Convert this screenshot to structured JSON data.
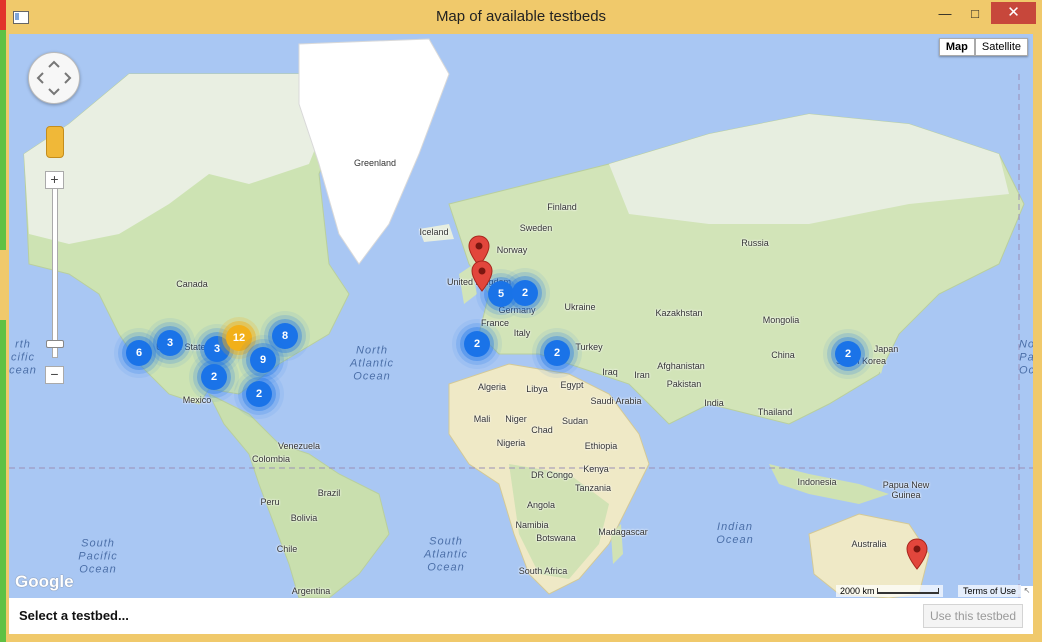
{
  "window": {
    "title": "Map of available testbeds",
    "minimize_glyph": "—",
    "maximize_glyph": "□",
    "close_glyph": "✕"
  },
  "map": {
    "maptype_buttons": [
      "Map",
      "Satellite"
    ],
    "active_maptype": "Map",
    "zoom_in": "+",
    "zoom_out": "−",
    "logo": "Google",
    "scale_text": "2000 km",
    "terms": "Terms of Use",
    "resize_glyph": "↖",
    "labels": [
      {
        "id": "greenland",
        "text": "Greenland"
      },
      {
        "id": "iceland",
        "text": "Iceland"
      },
      {
        "id": "finland",
        "text": "Finland"
      },
      {
        "id": "sweden",
        "text": "Sweden"
      },
      {
        "id": "norway",
        "text": "Norway"
      },
      {
        "id": "russia",
        "text": "Russia"
      },
      {
        "id": "united-kingdom",
        "text": "United Kingdom"
      },
      {
        "id": "germany",
        "text": "Germany"
      },
      {
        "id": "ukraine",
        "text": "Ukraine"
      },
      {
        "id": "france",
        "text": "France"
      },
      {
        "id": "italy",
        "text": "Italy"
      },
      {
        "id": "kazakhstan",
        "text": "Kazakhstan"
      },
      {
        "id": "mongolia",
        "text": "Mongolia"
      },
      {
        "id": "turkey",
        "text": "Turkey"
      },
      {
        "id": "china",
        "text": "China"
      },
      {
        "id": "japan",
        "text": "Japan"
      },
      {
        "id": "south-korea",
        "text": "South Korea"
      },
      {
        "id": "iraq",
        "text": "Iraq"
      },
      {
        "id": "iran",
        "text": "Iran"
      },
      {
        "id": "afghanistan",
        "text": "Afghanistan"
      },
      {
        "id": "pakistan",
        "text": "Pakistan"
      },
      {
        "id": "india",
        "text": "India"
      },
      {
        "id": "thailand",
        "text": "Thailand"
      },
      {
        "id": "saudi-arabia",
        "text": "Saudi Arabia"
      },
      {
        "id": "egypt",
        "text": "Egypt"
      },
      {
        "id": "algeria",
        "text": "Algeria"
      },
      {
        "id": "libya",
        "text": "Libya"
      },
      {
        "id": "mali",
        "text": "Mali"
      },
      {
        "id": "niger",
        "text": "Niger"
      },
      {
        "id": "chad",
        "text": "Chad"
      },
      {
        "id": "sudan",
        "text": "Sudan"
      },
      {
        "id": "nigeria",
        "text": "Nigeria"
      },
      {
        "id": "ethiopia",
        "text": "Ethiopia"
      },
      {
        "id": "dr-congo",
        "text": "DR Congo"
      },
      {
        "id": "kenya",
        "text": "Kenya"
      },
      {
        "id": "tanzania",
        "text": "Tanzania"
      },
      {
        "id": "angola",
        "text": "Angola"
      },
      {
        "id": "namibia",
        "text": "Namibia"
      },
      {
        "id": "botswana",
        "text": "Botswana"
      },
      {
        "id": "madagascar",
        "text": "Madagascar"
      },
      {
        "id": "south-africa",
        "text": "South Africa"
      },
      {
        "id": "indonesia",
        "text": "Indonesia"
      },
      {
        "id": "papua-new-guinea",
        "text": "Papua New\nGuinea"
      },
      {
        "id": "australia",
        "text": "Australia"
      },
      {
        "id": "canada",
        "text": "Canada"
      },
      {
        "id": "united-states",
        "text": "United States"
      },
      {
        "id": "mexico",
        "text": "Mexico"
      },
      {
        "id": "venezuela",
        "text": "Venezuela"
      },
      {
        "id": "colombia",
        "text": "Colombia"
      },
      {
        "id": "peru",
        "text": "Peru"
      },
      {
        "id": "brazil",
        "text": "Brazil"
      },
      {
        "id": "bolivia",
        "text": "Bolivia"
      },
      {
        "id": "chile",
        "text": "Chile"
      },
      {
        "id": "argentina",
        "text": "Argentina"
      }
    ],
    "oceans": [
      {
        "id": "north-atlantic",
        "text": "North\nAtlantic\nOcean"
      },
      {
        "id": "south-atlantic",
        "text": "South\nAtlantic\nOcean"
      },
      {
        "id": "south-pacific",
        "text": "South\nPacific\nOcean"
      },
      {
        "id": "indian",
        "text": "Indian\nOcean"
      },
      {
        "id": "north-pacific-left",
        "text": "rth\ncific\ncean"
      },
      {
        "id": "north-pacific-right",
        "text": "No\nPa\nOc"
      }
    ],
    "clusters": [
      {
        "id": "western-us",
        "count": "6",
        "color": "#1a73e8"
      },
      {
        "id": "us-mountain",
        "count": "3",
        "color": "#1a73e8"
      },
      {
        "id": "us-central",
        "count": "3",
        "color": "#1a73e8"
      },
      {
        "id": "us-great-lakes",
        "count": "12",
        "color": "#f2b019"
      },
      {
        "id": "us-east",
        "count": "8",
        "color": "#1a73e8"
      },
      {
        "id": "us-southeast",
        "count": "9",
        "color": "#1a73e8"
      },
      {
        "id": "us-texas",
        "count": "2",
        "color": "#1a73e8"
      },
      {
        "id": "us-gulf",
        "count": "2",
        "color": "#1a73e8"
      },
      {
        "id": "western-europe",
        "count": "5",
        "color": "#1a73e8"
      },
      {
        "id": "central-europe",
        "count": "2",
        "color": "#1a73e8"
      },
      {
        "id": "spain",
        "count": "2",
        "color": "#1a73e8"
      },
      {
        "id": "greece",
        "count": "2",
        "color": "#1a73e8"
      },
      {
        "id": "korea",
        "count": "2",
        "color": "#1a73e8"
      }
    ],
    "pins": [
      "scotland",
      "england",
      "australia-east"
    ]
  },
  "footer": {
    "status": "Select a testbed...",
    "use_button": "Use this testbed"
  }
}
